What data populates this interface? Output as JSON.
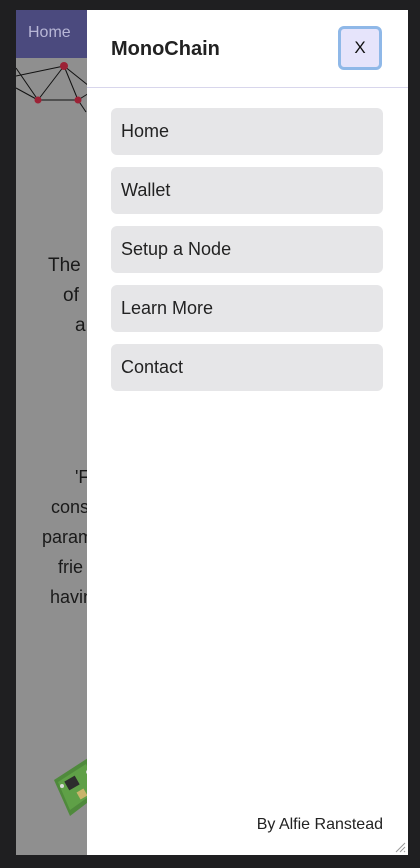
{
  "underlying_page": {
    "nav_home": "Home",
    "fragments": [
      "The",
      "of",
      "a",
      "'F",
      "cons",
      "param",
      "frie",
      "havin"
    ]
  },
  "drawer": {
    "title": "MonoChain",
    "close_label": "X",
    "menu": [
      {
        "label": "Home"
      },
      {
        "label": "Wallet"
      },
      {
        "label": "Setup a Node"
      },
      {
        "label": "Learn More"
      },
      {
        "label": "Contact"
      }
    ],
    "footer": "By Alfie Ranstead"
  },
  "colors": {
    "nav_bg": "#4b4a7e",
    "overlay_bg": "#8f8f8f",
    "close_bg": "#e6e4fb",
    "menu_item_bg": "#e6e6e8"
  }
}
